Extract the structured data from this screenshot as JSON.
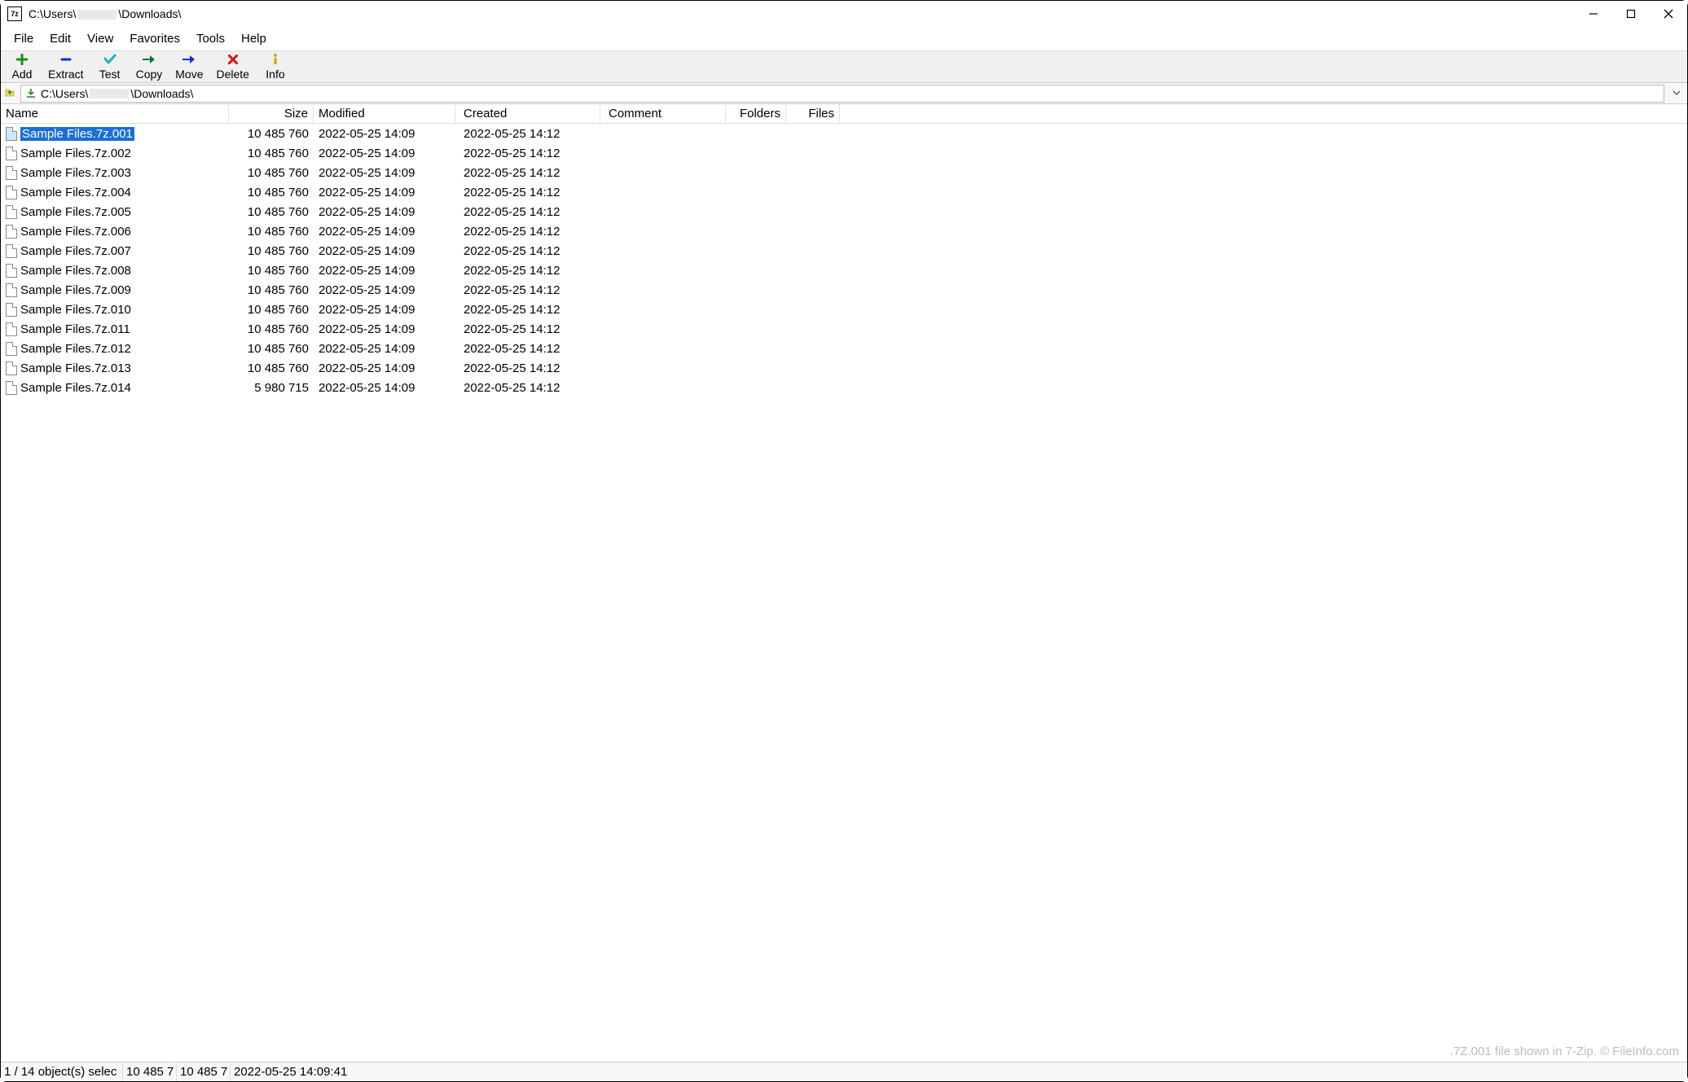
{
  "window": {
    "title_prefix": "C:\\Users\\",
    "title_redacted": true,
    "title_suffix": "\\Downloads\\"
  },
  "menu": {
    "items": [
      "File",
      "Edit",
      "View",
      "Favorites",
      "Tools",
      "Help"
    ]
  },
  "toolbar": {
    "items": [
      {
        "name": "add",
        "label": "Add"
      },
      {
        "name": "extract",
        "label": "Extract"
      },
      {
        "name": "test",
        "label": "Test"
      },
      {
        "name": "copy",
        "label": "Copy"
      },
      {
        "name": "move",
        "label": "Move"
      },
      {
        "name": "delete",
        "label": "Delete"
      },
      {
        "name": "info",
        "label": "Info"
      }
    ]
  },
  "address": {
    "prefix": "C:\\Users\\",
    "redacted": true,
    "suffix": "\\Downloads\\"
  },
  "columns": {
    "name": "Name",
    "size": "Size",
    "modified": "Modified",
    "created": "Created",
    "comment": "Comment",
    "folders": "Folders",
    "files": "Files"
  },
  "files": [
    {
      "name": "Sample Files.7z.001",
      "size": "10 485 760",
      "modified": "2022-05-25 14:09",
      "created": "2022-05-25 14:12",
      "selected": true
    },
    {
      "name": "Sample Files.7z.002",
      "size": "10 485 760",
      "modified": "2022-05-25 14:09",
      "created": "2022-05-25 14:12"
    },
    {
      "name": "Sample Files.7z.003",
      "size": "10 485 760",
      "modified": "2022-05-25 14:09",
      "created": "2022-05-25 14:12"
    },
    {
      "name": "Sample Files.7z.004",
      "size": "10 485 760",
      "modified": "2022-05-25 14:09",
      "created": "2022-05-25 14:12"
    },
    {
      "name": "Sample Files.7z.005",
      "size": "10 485 760",
      "modified": "2022-05-25 14:09",
      "created": "2022-05-25 14:12"
    },
    {
      "name": "Sample Files.7z.006",
      "size": "10 485 760",
      "modified": "2022-05-25 14:09",
      "created": "2022-05-25 14:12"
    },
    {
      "name": "Sample Files.7z.007",
      "size": "10 485 760",
      "modified": "2022-05-25 14:09",
      "created": "2022-05-25 14:12"
    },
    {
      "name": "Sample Files.7z.008",
      "size": "10 485 760",
      "modified": "2022-05-25 14:09",
      "created": "2022-05-25 14:12"
    },
    {
      "name": "Sample Files.7z.009",
      "size": "10 485 760",
      "modified": "2022-05-25 14:09",
      "created": "2022-05-25 14:12"
    },
    {
      "name": "Sample Files.7z.010",
      "size": "10 485 760",
      "modified": "2022-05-25 14:09",
      "created": "2022-05-25 14:12"
    },
    {
      "name": "Sample Files.7z.011",
      "size": "10 485 760",
      "modified": "2022-05-25 14:09",
      "created": "2022-05-25 14:12"
    },
    {
      "name": "Sample Files.7z.012",
      "size": "10 485 760",
      "modified": "2022-05-25 14:09",
      "created": "2022-05-25 14:12"
    },
    {
      "name": "Sample Files.7z.013",
      "size": "10 485 760",
      "modified": "2022-05-25 14:09",
      "created": "2022-05-25 14:12"
    },
    {
      "name": "Sample Files.7z.014",
      "size": "5 980 715",
      "modified": "2022-05-25 14:09",
      "created": "2022-05-25 14:12"
    }
  ],
  "watermark": ".7Z.001 file shown in 7-Zip. © FileInfo.com",
  "status": {
    "selection": "1 / 14 object(s) selec",
    "size1": "10 485 7",
    "size2": "10 485 7",
    "datetime": "2022-05-25 14:09:41"
  }
}
